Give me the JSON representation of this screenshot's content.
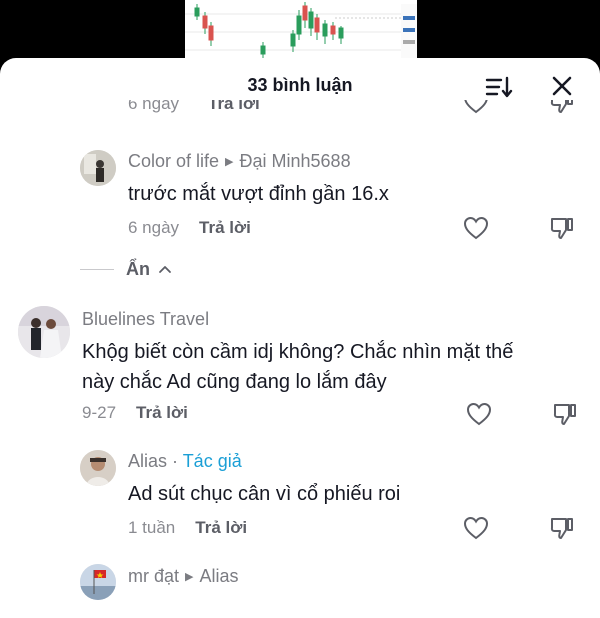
{
  "header": {
    "title": "33 bình luận"
  },
  "icons": {
    "sort": "sort-icon",
    "close": "close-icon",
    "heart": "heart-icon",
    "dislike": "dislike-icon",
    "chevron": "chevron-up-icon"
  },
  "clipped_row": {
    "date": "6 ngày",
    "reply": "Trả lời"
  },
  "comments": [
    {
      "user": "Color of life",
      "reply_to": "Đại Minh5688",
      "text": "trước mắt vượt đỉnh gần 16.x",
      "date": "6 ngày",
      "reply": "Trả lời"
    },
    {
      "user": "Bluelines Travel",
      "text_line1": "Khộg biết còn cầm idj không? Chắc nhìn mặt thế",
      "text_line2": "này chắc Ad cũng đang lo lắm đây",
      "date": "9-27",
      "reply": "Trả lời"
    },
    {
      "user": "Alias",
      "author_sep": " · ",
      "author_label": "Tác giả",
      "text": "Ad sút chục cân vì cổ phiếu roi",
      "date": "1 tuần",
      "reply": "Trả lời"
    },
    {
      "user": "mr đạt",
      "reply_to": "Alias"
    }
  ],
  "collapse": {
    "label": "Ẩn"
  },
  "colors": {
    "author_tag": "#1b9fd6",
    "muted": "#8a8b91",
    "text": "#161823"
  }
}
